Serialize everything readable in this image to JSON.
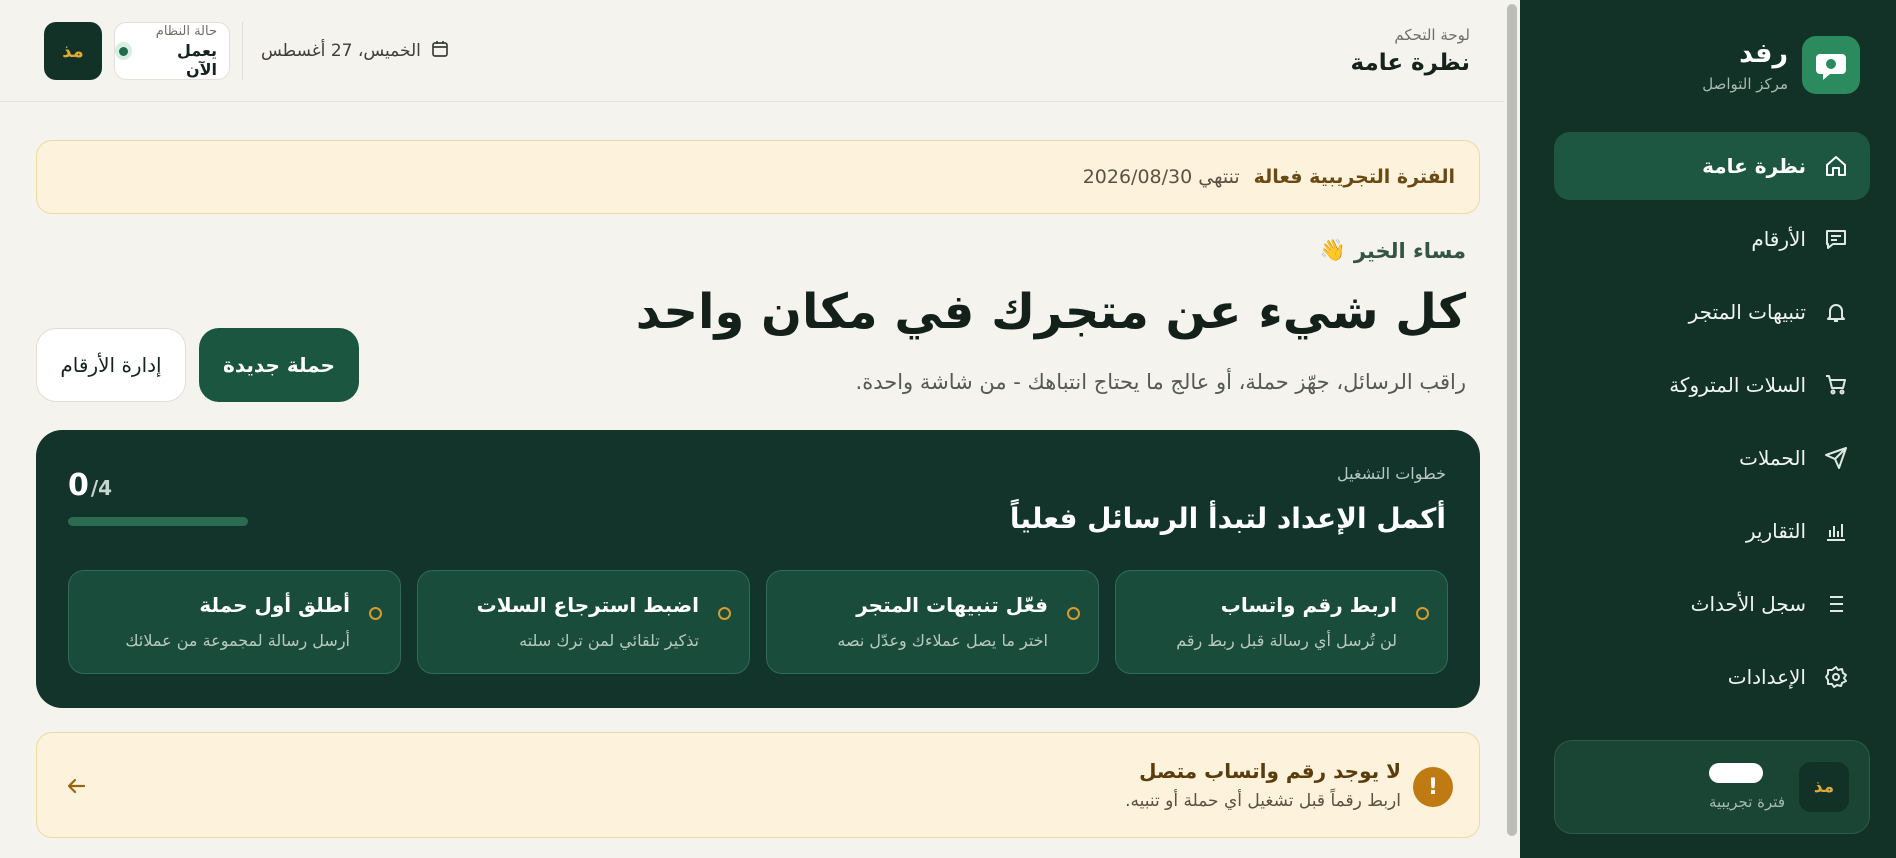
{
  "colors": {
    "sidebar_bg": "#123227",
    "accent_green": "#1a5640",
    "accent_gold": "#e0a93b",
    "banner_bg": "#fdf3dd",
    "page_bg": "#f4f3ee"
  },
  "sidebar": {
    "brand": {
      "name": "رفد",
      "subtitle": "مركز التواصل",
      "icon": "chat-bubble-icon"
    },
    "items": [
      {
        "label": "نظرة عامة",
        "icon": "home-icon",
        "active": true
      },
      {
        "label": "الأرقام",
        "icon": "message-icon",
        "active": false
      },
      {
        "label": "تنبيهات المتجر",
        "icon": "bell-icon",
        "active": false
      },
      {
        "label": "السلات المتروكة",
        "icon": "cart-icon",
        "active": false
      },
      {
        "label": "الحملات",
        "icon": "send-icon",
        "active": false
      },
      {
        "label": "التقارير",
        "icon": "bar-chart-icon",
        "active": false
      },
      {
        "label": "سجل الأحداث",
        "icon": "list-icon",
        "active": false
      },
      {
        "label": "الإعدادات",
        "icon": "gear-icon",
        "active": false
      }
    ],
    "user": {
      "initials": "مذ",
      "plan": "فترة تجريبية"
    }
  },
  "header": {
    "crumb": "لوحة التحكم",
    "title": "نظرة عامة",
    "date": "الخميس، 27 أغسطس",
    "status_label": "حالة النظام",
    "status_value": "يعمل الآن",
    "user_initials": "مذ"
  },
  "trial": {
    "title": "الفترة التجريبية فعالة",
    "ends": "تنتهي 2026/08/30"
  },
  "hero": {
    "greeting": "مساء الخير",
    "greeting_emoji": "👋",
    "title": "كل شيء عن متجرك في مكان واحد",
    "subtitle": "راقب الرسائل، جهّز حملة، أو عالج ما يحتاج انتباهك - من شاشة واحدة.",
    "primary_button": "حملة جديدة",
    "secondary_button": "إدارة الأرقام"
  },
  "setup": {
    "kicker": "خطوات التشغيل",
    "title": "أكمل الإعداد لتبدأ الرسائل فعلياً",
    "progress_done": "0",
    "progress_total": "/4",
    "progress_fraction": 0,
    "steps": [
      {
        "title": "اربط رقم واتساب",
        "desc": "لن تُرسل أي رسالة قبل ربط رقم"
      },
      {
        "title": "فعّل تنبيهات المتجر",
        "desc": "اختر ما يصل عملاءك وعدّل نصه"
      },
      {
        "title": "اضبط استرجاع السلات",
        "desc": "تذكير تلقائي لمن ترك سلته"
      },
      {
        "title": "أطلق أول حملة",
        "desc": "أرسل رسالة لمجموعة من عملائك"
      }
    ]
  },
  "alert": {
    "title": "لا يوجد رقم واتساب متصل",
    "desc": "اربط رقماً قبل تشغيل أي حملة أو تنبيه.",
    "icon": "exclamation-icon",
    "arrow": "arrow-left-icon"
  }
}
